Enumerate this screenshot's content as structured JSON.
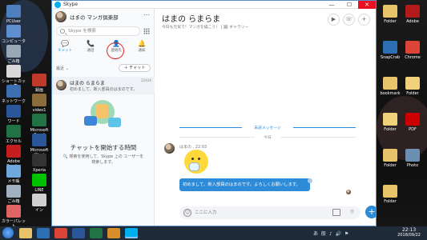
{
  "desktop": {
    "left_icons": [
      {
        "label": "PCUser",
        "color": "#4e7fbf"
      },
      {
        "label": "コンピューター",
        "color": "#5f8fcf"
      },
      {
        "label": "ごみ箱",
        "color": "#9aa8b5"
      },
      {
        "label": "ショートカット集",
        "color": "#d9d9d9"
      },
      {
        "label": "ネットワーク",
        "color": "#3c6fb0"
      },
      {
        "label": "ワード",
        "color": "#2b579a"
      },
      {
        "label": "エクセル",
        "color": "#217346"
      },
      {
        "label": "Adobe Reader",
        "color": "#c41e1e"
      },
      {
        "label": "メモ帳",
        "color": "#6fa8dc"
      },
      {
        "label": "ごみ箱",
        "color": "#a0b0c0"
      },
      {
        "label": "カラーパレット",
        "color": "#e06666"
      }
    ],
    "mid_icons": [
      {
        "label": "録画",
        "color": "#c0392b"
      },
      {
        "label": "video1",
        "color": "#8a6d3b"
      },
      {
        "label": "Microsoft Excel",
        "color": "#217346"
      },
      {
        "label": "Microsoft Word",
        "color": "#2b579a"
      },
      {
        "label": "Xperia",
        "color": "#333333"
      },
      {
        "label": "LINE",
        "color": "#00c300"
      },
      {
        "label": "イン",
        "color": "#d0d0d0"
      }
    ],
    "right_icons": [
      {
        "label": "Folder",
        "color": "#e8c36a"
      },
      {
        "label": "Adobe",
        "color": "#b31b1b"
      },
      {
        "label": "SnapCrab",
        "color": "#2d6fb5"
      },
      {
        "label": "Chrome",
        "color": "#db4437"
      },
      {
        "label": "bookmark",
        "color": "#e8c36a"
      },
      {
        "label": "Folder",
        "color": "#f1d27a"
      },
      {
        "label": "Folder",
        "color": "#f1d27a"
      },
      {
        "label": "PDF",
        "color": "#cc0000"
      },
      {
        "label": "Folder",
        "color": "#e8c36a"
      },
      {
        "label": "Photo",
        "color": "#6b8fb0"
      },
      {
        "label": "Folder",
        "color": "#e8c36a"
      }
    ]
  },
  "window": {
    "title": "Skype",
    "controls": {
      "minimize": "—",
      "maximize": "☐",
      "close": "✕"
    }
  },
  "sidebar": {
    "profile_name": "はまの マンガ倶楽部",
    "more_icon": "⋯",
    "search_placeholder": "Skype を検索",
    "tabs": [
      {
        "label": "チャット",
        "icon": "💬",
        "active": true
      },
      {
        "label": "通話",
        "icon": "📞",
        "active": false
      },
      {
        "label": "連絡先",
        "icon": "👤",
        "active": false
      },
      {
        "label": "通知",
        "icon": "🔔",
        "active": false
      }
    ],
    "recent_label": "最近 ⌄",
    "new_chat_label": "＋ チャット",
    "chats": [
      {
        "name": "はまの らまらま",
        "preview": "初めまして、新入部員のはまのです。",
        "date": "22/04"
      }
    ],
    "empty_title": "チャットを開始する時間",
    "empty_desc": "🔍 検索を使用して、Skype 上の ユーザーを検索します。"
  },
  "conversation": {
    "title": "はまの らまらま",
    "subtitle": "今日も元気で！マンガを描こう！ | 🖼 ギャラリー",
    "header_icons": [
      "video-call",
      "audio-call",
      "add-person"
    ],
    "unread_label": "未読メッセージ",
    "today_label": "今日",
    "sender": "はまの , 22:03",
    "message": "初めまして、新入部員のはまのです。よろしくお願いします。",
    "compose_placeholder": "ここに入力",
    "send_icon": "+"
  },
  "taskbar": {
    "apps": [
      {
        "name": "explorer",
        "color": "#e8c36a"
      },
      {
        "name": "media",
        "color": "#2d6fb5"
      },
      {
        "name": "chrome",
        "color": "#db4437"
      },
      {
        "name": "word",
        "color": "#2b579a"
      },
      {
        "name": "excel",
        "color": "#217346"
      },
      {
        "name": "paint",
        "color": "#d98e2b"
      },
      {
        "name": "skype",
        "color": "#00aff0",
        "active": true
      }
    ],
    "tray": "あ 般 ♪ 🔊 ⚑",
    "time": "22:13",
    "date": "2018/09/22"
  },
  "colors": {
    "accent": "#00a2ed",
    "message_bubble": "#2e8bd8",
    "highlight_circle": "#e0201b"
  }
}
